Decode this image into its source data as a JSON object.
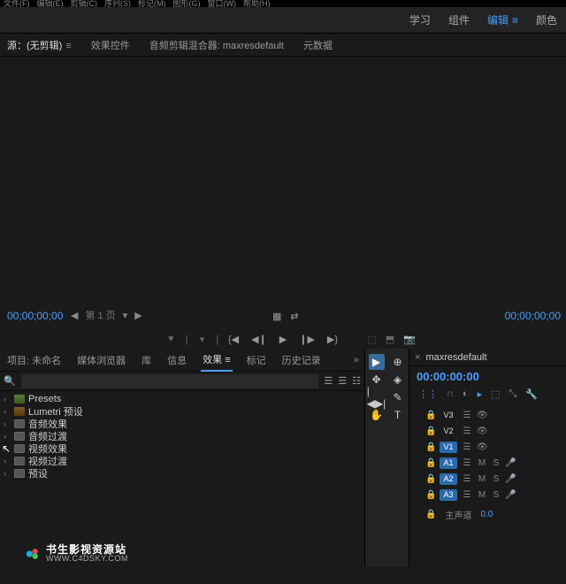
{
  "menu": [
    "文件(F)",
    "编辑(E)",
    "剪辑(C)",
    "序列(S)",
    "标记(M)",
    "图形(G)",
    "窗口(W)",
    "帮助(H)"
  ],
  "workspaces": {
    "items": [
      "学习",
      "组件",
      "编辑",
      "颜色"
    ],
    "active": "编辑",
    "underline": "≡"
  },
  "source_tabs": {
    "items": [
      {
        "label": "源：(无剪辑)",
        "suffix": "≡",
        "active": true
      },
      {
        "label": "效果控件"
      },
      {
        "label": "音频剪辑混合器: maxresdefault"
      },
      {
        "label": "元数据"
      }
    ]
  },
  "source_panel": {
    "timecode_left": "00;00;00;00",
    "timecode_right": "00;00;00;00",
    "pager": {
      "prev": "◀",
      "label": "第 1 页",
      "sep": "▾",
      "next": "▶"
    },
    "center": {
      "grid": "▦",
      "arrows": "⇄"
    },
    "markers": {
      "m1": "♥",
      "m2": "❘",
      "m3": "▾",
      "m4": "❘"
    },
    "transport": {
      "in": "{◀",
      "back": "◀❙",
      "play": "▶",
      "fwd": "❙▶",
      "out": "▶}"
    },
    "right": {
      "i1": "⬚",
      "i2": "⬒",
      "i3": "📷"
    }
  },
  "project_tabs": {
    "items": [
      "项目: 未命名",
      "媒体浏览器",
      "库",
      "信息",
      "效果",
      "标记",
      "历史记录"
    ],
    "active": "效果",
    "more": "»"
  },
  "search": {
    "placeholder": "",
    "icon": "🔍",
    "b1": "☰",
    "b2": "☰",
    "b3": "☷"
  },
  "effects_tree": [
    {
      "label": "Presets",
      "icon": "preset"
    },
    {
      "label": "Lumetri 预设",
      "icon": "lumetri"
    },
    {
      "label": "音频效果",
      "icon": "plain"
    },
    {
      "label": "音频过渡",
      "icon": "plain"
    },
    {
      "label": "视频效果",
      "icon": "plain"
    },
    {
      "label": "视频过渡",
      "icon": "plain"
    },
    {
      "label": "预设",
      "icon": "plain"
    }
  ],
  "tools": {
    "t1": "▶",
    "t2": "⊕",
    "t3": "✥",
    "t4": "◈",
    "t5": "|◀▶|",
    "t6": "✎",
    "t7": "✋",
    "t8": "T"
  },
  "timeline": {
    "tab": "maxresdefault",
    "close": "×",
    "timecode": "00:00:00:00",
    "opts": {
      "o1": "⋮⋮",
      "o2": "∩",
      "o3": "◐",
      "o4": "▸",
      "o5": "⬚",
      "o6": "⤡",
      "o7": "🔧"
    },
    "video_tracks": [
      {
        "name": "V3",
        "active": false
      },
      {
        "name": "V2",
        "active": false
      },
      {
        "name": "V1",
        "active": true
      }
    ],
    "audio_tracks": [
      {
        "name": "A1",
        "active": true
      },
      {
        "name": "A2",
        "active": true
      },
      {
        "name": "A3",
        "active": true
      }
    ],
    "icons": {
      "lock": "🔒",
      "toggle": "☰",
      "eye": "👁",
      "m": "M",
      "s": "S",
      "mic": "🎤",
      "o": "o"
    },
    "master": {
      "label": "主声道",
      "value": "0.0"
    }
  },
  "watermark": {
    "cn": "书生影视资源站",
    "en": "WWW.C4DSKY.COM"
  }
}
